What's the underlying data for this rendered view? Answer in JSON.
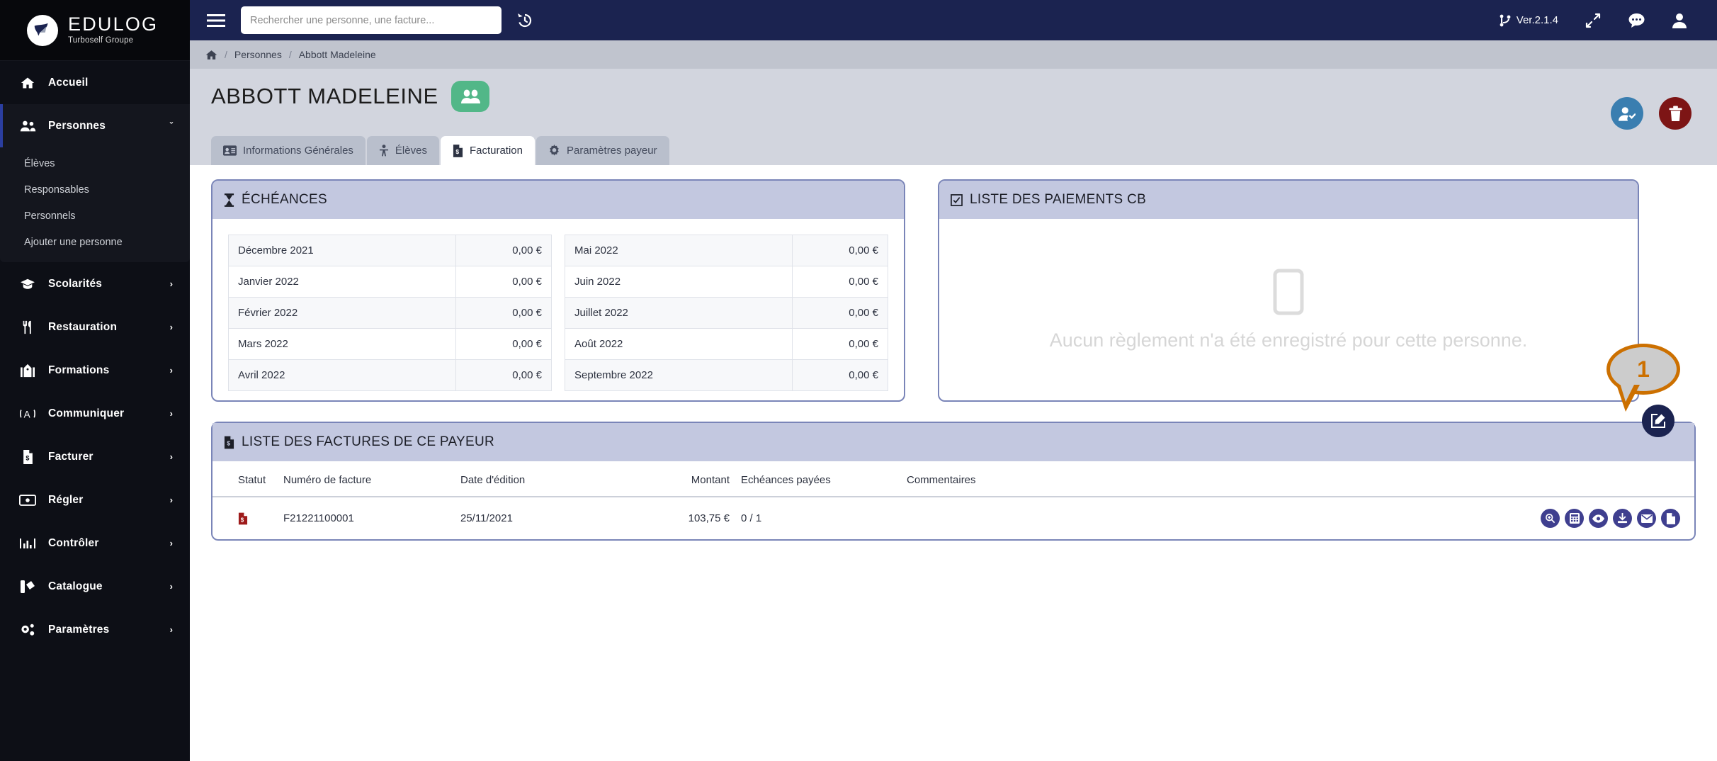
{
  "brand": {
    "name": "EDULOG",
    "tagline": "Turboself Groupe",
    "logo_icon": "bird-logo-icon"
  },
  "topbar": {
    "menu_icon": "hamburger-icon",
    "search": {
      "placeholder": "Rechercher une personne, une facture...",
      "value": "",
      "icon": "search-input"
    },
    "history_icon": "history-clock-icon",
    "version_label": "Ver.2.1.4",
    "version_icon": "code-branch-icon",
    "expand_icon": "expand-arrows-icon",
    "chat_icon": "chat-bubble-icon",
    "user_icon": "user-icon",
    "background": "#1b2350"
  },
  "sidebar": {
    "items": [
      {
        "label": "Accueil",
        "icon": "home-icon",
        "caret": "",
        "active": false
      },
      {
        "label": "Personnes",
        "icon": "users-icon",
        "caret": "ˇ",
        "active": true
      },
      {
        "label": "Scolarités",
        "icon": "graduation-cap-icon",
        "caret": "›",
        "active": false
      },
      {
        "label": "Restauration",
        "icon": "utensils-icon",
        "caret": "›",
        "active": false
      },
      {
        "label": "Formations",
        "icon": "school-building-icon",
        "caret": "›",
        "active": false
      },
      {
        "label": "Communiquer",
        "icon": "bullhorn-icon",
        "caret": "›",
        "active": false
      },
      {
        "label": "Facturer",
        "icon": "invoice-icon",
        "caret": "›",
        "active": false
      },
      {
        "label": "Régler",
        "icon": "money-bill-icon",
        "caret": "›",
        "active": false
      },
      {
        "label": "Contrôler",
        "icon": "chart-bar-icon",
        "caret": "›",
        "active": false
      },
      {
        "label": "Catalogue",
        "icon": "swatchbook-icon",
        "caret": "›",
        "active": false
      },
      {
        "label": "Paramètres",
        "icon": "cogs-icon",
        "caret": "›",
        "active": false
      }
    ],
    "submenu": [
      {
        "label": "Élèves"
      },
      {
        "label": "Responsables"
      },
      {
        "label": "Personnels"
      },
      {
        "label": "Ajouter une personne"
      }
    ]
  },
  "breadcrumb": {
    "home_icon": "home-icon",
    "items": [
      "Personnes",
      "Abbott Madeleine"
    ],
    "separator": "/"
  },
  "page": {
    "title": "ABBOTT MADELEINE",
    "badge_icon": "users-group-icon",
    "badge_color": "#52b788",
    "actions": [
      {
        "name": "add-person-button",
        "icon": "user-check-icon",
        "color": "#3a7eb0"
      },
      {
        "name": "delete-person-button",
        "icon": "trash-icon",
        "color": "#7d1515"
      }
    ]
  },
  "tabs": [
    {
      "label": "Informations Générales",
      "icon": "id-card-icon",
      "active": false
    },
    {
      "label": "Élèves",
      "icon": "child-icon",
      "active": false
    },
    {
      "label": "Facturation",
      "icon": "invoice-icon",
      "active": true
    },
    {
      "label": "Paramètres payeur",
      "icon": "gear-icon",
      "active": false
    }
  ],
  "echeances": {
    "title": "ÉCHÉANCES",
    "icon": "hourglass-icon",
    "left_rows": [
      {
        "month": "Décembre 2021",
        "amount": "0,00 €"
      },
      {
        "month": "Janvier 2022",
        "amount": "0,00 €"
      },
      {
        "month": "Février 2022",
        "amount": "0,00 €"
      },
      {
        "month": "Mars 2022",
        "amount": "0,00 €"
      },
      {
        "month": "Avril 2022",
        "amount": "0,00 €"
      }
    ],
    "right_rows": [
      {
        "month": "Mai 2022",
        "amount": "0,00 €"
      },
      {
        "month": "Juin 2022",
        "amount": "0,00 €"
      },
      {
        "month": "Juillet 2022",
        "amount": "0,00 €"
      },
      {
        "month": "Août 2022",
        "amount": "0,00 €"
      },
      {
        "month": "Septembre 2022",
        "amount": "0,00 €"
      }
    ]
  },
  "paiements_cb": {
    "title": "LISTE DES PAIEMENTS CB",
    "icon": "checkbox-icon",
    "empty_icon": "credit-card-empty-icon",
    "empty_message": "Aucun règlement n'a été enregistré pour cette personne."
  },
  "factures": {
    "title": "LISTE DES FACTURES DE CE PAYEUR",
    "icon": "invoice-icon",
    "edit_button_icon": "edit-pencil-icon",
    "callout": {
      "number": "1",
      "color": "#cc7000"
    },
    "columns": [
      "Statut",
      "Numéro de facture",
      "Date d'édition",
      "Montant",
      "Echéances payées",
      "Commentaires"
    ],
    "rows": [
      {
        "statut_icon": "invoice-red-icon",
        "numero": "F21221100001",
        "date": "25/11/2021",
        "montant": "103,75 €",
        "echeances_payees": "0 / 1",
        "commentaires": "",
        "actions": [
          {
            "name": "zoom-invoice-icon"
          },
          {
            "name": "calculator-icon"
          },
          {
            "name": "eye-view-icon"
          },
          {
            "name": "download-icon"
          },
          {
            "name": "email-icon"
          },
          {
            "name": "duplicate-file-icon"
          }
        ]
      }
    ]
  },
  "colors": {
    "sidebar_bg": "#0d0f16",
    "topbar_bg": "#1b2350",
    "panel_border": "#7a85b8",
    "panel_head_bg": "#c3c8e0",
    "accent_green": "#52b788",
    "callout_orange": "#cc7000"
  }
}
